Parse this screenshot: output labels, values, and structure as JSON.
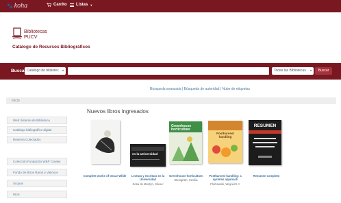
{
  "topbar": {
    "logo_text": "koha",
    "cart_label": "Carrito",
    "lists_label": "Listas"
  },
  "library": {
    "name_line1": "Bibliotecas",
    "name_line2": "PUCV",
    "subtitle": "Catálogo de Recursos Bibliográficos"
  },
  "search": {
    "label": "Buscar",
    "catalog_option": "Catálogo de bibliotec",
    "library_option": "Todas las Bibliotecas",
    "button_label": "Buscar"
  },
  "links": {
    "text": "Búsqueda avanzada | Búsqueda de autoridad | Nube de etiquetas"
  },
  "breadcrumb": {
    "home": "Inicio"
  },
  "sidebar": {
    "items": [
      {
        "label": "Web Sistema de Biblioteca"
      },
      {
        "label": "Catálogo bibliográfico digital"
      },
      {
        "label": "Reserva Colectados"
      },
      {
        "label": "Colección Fundación W&P Cowley"
      },
      {
        "label": "Fondo de libros Raros y Valiosos"
      },
      {
        "label": "Scopus"
      },
      {
        "label": "WoS"
      }
    ]
  },
  "main": {
    "section_title": "Nuevos libros ingresados",
    "books": [
      {
        "title": "Complete works of Oscar Wilde",
        "author": "",
        "cover_text": ""
      },
      {
        "title": "Lectura y escritura en la Universidad",
        "author": "Sosa de Montyn, Silvia /",
        "cover_text": "en la Universidad"
      },
      {
        "title": "Greenhouse horticulture.",
        "author": "Steingrüm, Cecilia.",
        "cover_text": "Greenhouse horticulture"
      },
      {
        "title": "Postharvest handling: a systems approach",
        "author": "Florkowski, Wojciech J.",
        "cover_text": "Postharvest handling"
      },
      {
        "title": "Resumen completo",
        "author": "",
        "cover_text": "RESUMEN"
      }
    ]
  },
  "colors": {
    "brand": "#7a1822",
    "link": "#3b6f9a"
  }
}
